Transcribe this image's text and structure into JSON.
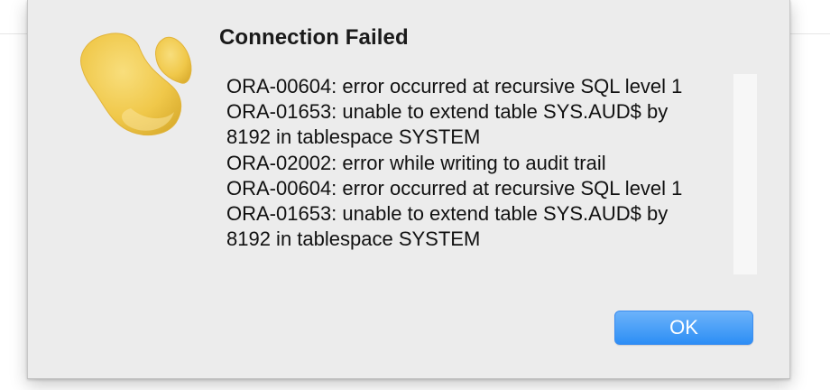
{
  "dialog": {
    "icon": "navicat-logo-icon",
    "title": "Connection Failed",
    "message_lines": [
      "ORA-00604: error occurred at recursive SQL level 1",
      "ORA-01653: unable to extend table SYS.AUD$ by",
      "8192 in tablespace SYSTEM",
      "ORA-02002: error while writing to audit trail",
      "ORA-00604: error occurred at recursive SQL level 1",
      "ORA-01653: unable to extend table SYS.AUD$ by",
      "8192 in tablespace SYSTEM"
    ],
    "ok_label": "OK"
  },
  "colors": {
    "logo_yellow": "#f2cc52",
    "button_blue": "#2d8ef5",
    "dialog_bg": "#ececec"
  }
}
